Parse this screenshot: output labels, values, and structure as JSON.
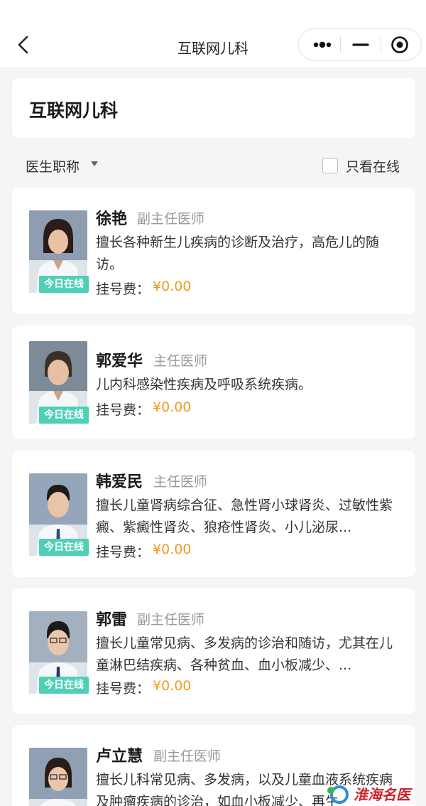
{
  "navbar": {
    "title": "互联网儿科"
  },
  "header": {
    "title": "互联网儿科"
  },
  "filter": {
    "title_label": "医生职称",
    "online_only_label": "只看在线"
  },
  "doctors": [
    {
      "name": "徐艳",
      "title": "副主任医师",
      "desc": "擅长各种新生儿疾病的诊断及治疗，高危儿的随访。",
      "badge": "今日在线",
      "fee_label": "挂号费：",
      "fee": "¥0.00"
    },
    {
      "name": "郭爱华",
      "title": "主任医师",
      "desc": "儿内科感染性疾病及呼吸系统疾病。",
      "badge": "今日在线",
      "fee_label": "挂号费：",
      "fee": "¥0.00"
    },
    {
      "name": "韩爱民",
      "title": "主任医师",
      "desc": "擅长儿童肾病综合征、急性肾小球肾炎、过敏性紫癜、紫癜性肾炎、狼疮性肾炎、小儿泌尿...",
      "badge": "今日在线",
      "fee_label": "挂号费：",
      "fee": "¥0.00"
    },
    {
      "name": "郭雷",
      "title": "副主任医师",
      "desc": "擅长儿童常见病、多发病的诊治和随访，尤其在儿童淋巴结疾病、各种贫血、血小板减少、...",
      "badge": "今日在线",
      "fee_label": "挂号费：",
      "fee": "¥0.00"
    },
    {
      "name": "卢立慧",
      "title": "副主任医师",
      "desc": "擅长儿科常见病、多发病，以及儿童血液系统疾病及肿瘤疾病的诊治，如血小板减少、再生"
    }
  ],
  "watermark": {
    "text": "淮海名医网"
  }
}
